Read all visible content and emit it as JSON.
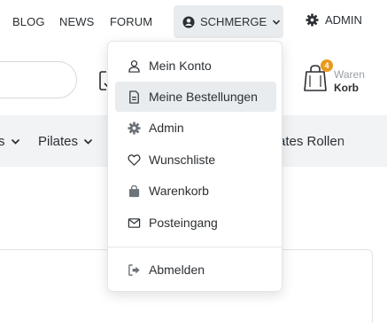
{
  "topnav": {
    "blog": "BLOG",
    "news": "NEWS",
    "forum": "FORUM",
    "user": "SCHMERGE",
    "admin": "ADMIN"
  },
  "cart": {
    "badge_count": "4",
    "label_top": "Waren",
    "label_bottom": "Korb"
  },
  "categories": {
    "partial_left": "s",
    "pilates": "Pilates",
    "partial_right": "ates Rollen"
  },
  "user_menu": {
    "items": [
      {
        "label": "Mein Konto",
        "icon": "user-icon"
      },
      {
        "label": "Meine Bestellungen",
        "icon": "document-icon"
      },
      {
        "label": "Admin",
        "icon": "gear-icon"
      },
      {
        "label": "Wunschliste",
        "icon": "heart-icon"
      },
      {
        "label": "Warenkorb",
        "icon": "bag-icon"
      },
      {
        "label": "Posteingang",
        "icon": "envelope-icon"
      }
    ],
    "logout": {
      "label": "Abmelden",
      "icon": "logout-icon"
    }
  },
  "colors": {
    "badge": "#e89a1c",
    "active_item_bg": "#e9ecef",
    "category_bar_bg": "#f1f3f5"
  }
}
